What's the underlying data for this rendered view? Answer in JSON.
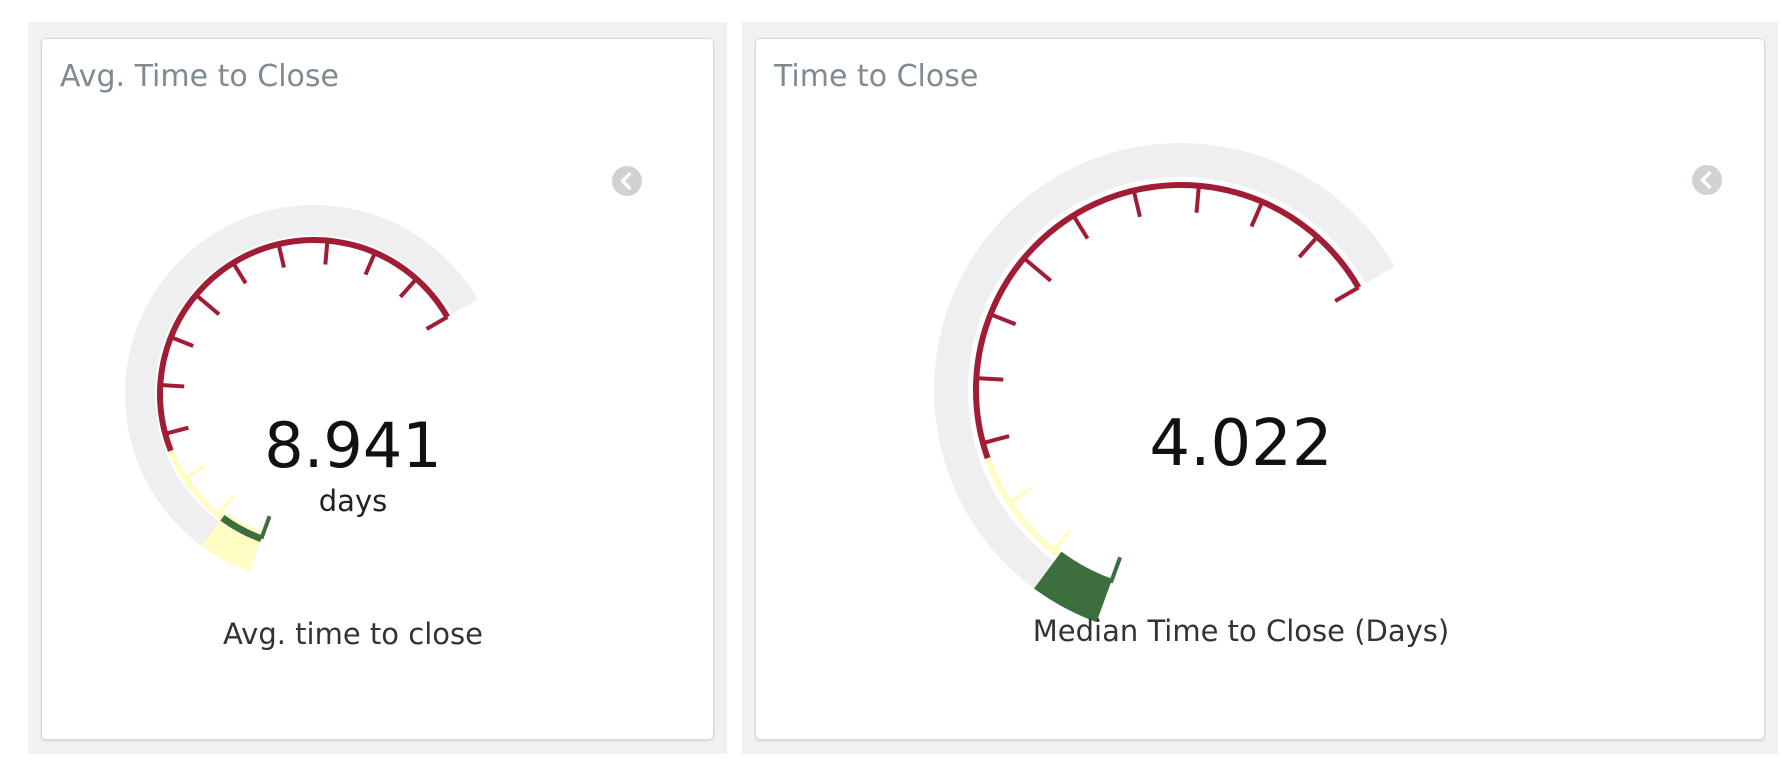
{
  "colors": {
    "green": "#3d6e3f",
    "yellow": "#fffcc4",
    "red": "#a11d36",
    "track": "#efefef",
    "title": "#7f8a92"
  },
  "widgets": [
    {
      "title": "Avg. Time to Close",
      "value": "8.941",
      "unit": "days",
      "label": "Avg. time to close",
      "collapse_icon": "chevron-left-circle-icon"
    },
    {
      "title": "Time to Close",
      "value": "4.022",
      "unit": "",
      "label": "Median Time to Close (Days)",
      "collapse_icon": "chevron-left-circle-icon"
    }
  ],
  "chart_data": [
    {
      "type": "gauge",
      "title": "Avg. Time to Close",
      "value": 8.941,
      "unit": "days",
      "label": "Avg. time to close",
      "bands": [
        {
          "color": "green",
          "from_fraction": 0.0,
          "to_fraction": 0.07
        },
        {
          "color": "yellow",
          "from_fraction": 0.07,
          "to_fraction": 0.22
        },
        {
          "color": "red",
          "from_fraction": 0.22,
          "to_fraction": 1.0
        }
      ],
      "minor_ticks": 13,
      "major_tick_index": 6
    },
    {
      "type": "gauge",
      "title": "Time to Close",
      "value": 4.022,
      "unit": "",
      "label": "Median Time to Close (Days)",
      "bands": [
        {
          "color": "green",
          "from_fraction": 0.0,
          "to_fraction": 0.07
        },
        {
          "color": "yellow",
          "from_fraction": 0.07,
          "to_fraction": 0.23
        },
        {
          "color": "red",
          "from_fraction": 0.23,
          "to_fraction": 1.0
        }
      ],
      "minor_ticks": 13,
      "major_tick_index": 6
    }
  ]
}
